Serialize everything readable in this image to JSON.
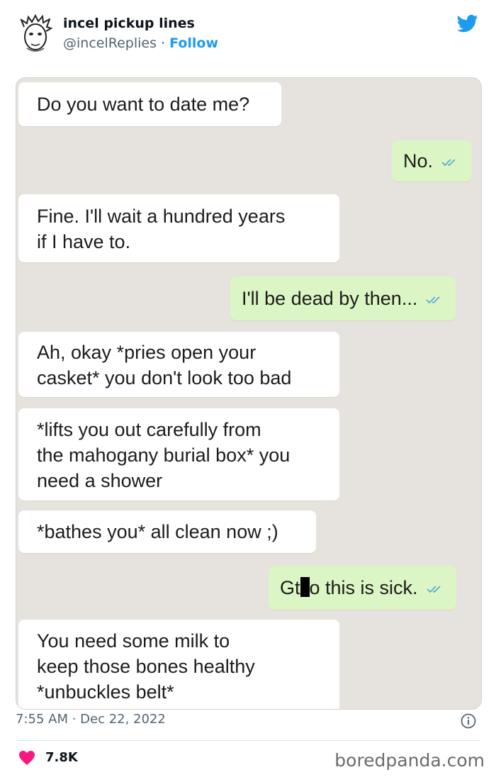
{
  "tweet": {
    "display_name": "incel pickup lines",
    "handle": "@incelReplies",
    "separator": " · ",
    "follow_label": "Follow",
    "timestamp": "7:55 AM · Dec 22, 2022",
    "likes": "7.8K",
    "brand_color": "#1d9bf0"
  },
  "chat": {
    "messages": [
      {
        "side": "incoming",
        "text": "Do you want to date me?"
      },
      {
        "side": "outgoing",
        "text": "No."
      },
      {
        "side": "incoming",
        "text": "Fine. I'll wait a hundred years\nif I have to."
      },
      {
        "side": "outgoing",
        "text": "I'll be dead by then..."
      },
      {
        "side": "incoming",
        "text": "Ah, okay *pries open your\ncasket* you don't look too bad"
      },
      {
        "side": "incoming",
        "text": "*lifts you out carefully from\nthe mahogany burial box* you\nneed a shower"
      },
      {
        "side": "incoming",
        "text": "*bathes you* all clean now ;)"
      },
      {
        "side": "outgoing",
        "text_before": "Gt",
        "text_after": "o this is sick."
      },
      {
        "side": "incoming",
        "text": "You need some milk to\nkeep those bones healthy\n*unbuckles belt*"
      }
    ],
    "incoming_color": "#ffffff",
    "outgoing_color": "#dcf5c4",
    "background_color": "#e6e3df"
  },
  "icons": [
    "twitter-bird-icon",
    "info-icon",
    "heart-icon",
    "double-check-icon"
  ],
  "watermark": "boredpanda.com"
}
